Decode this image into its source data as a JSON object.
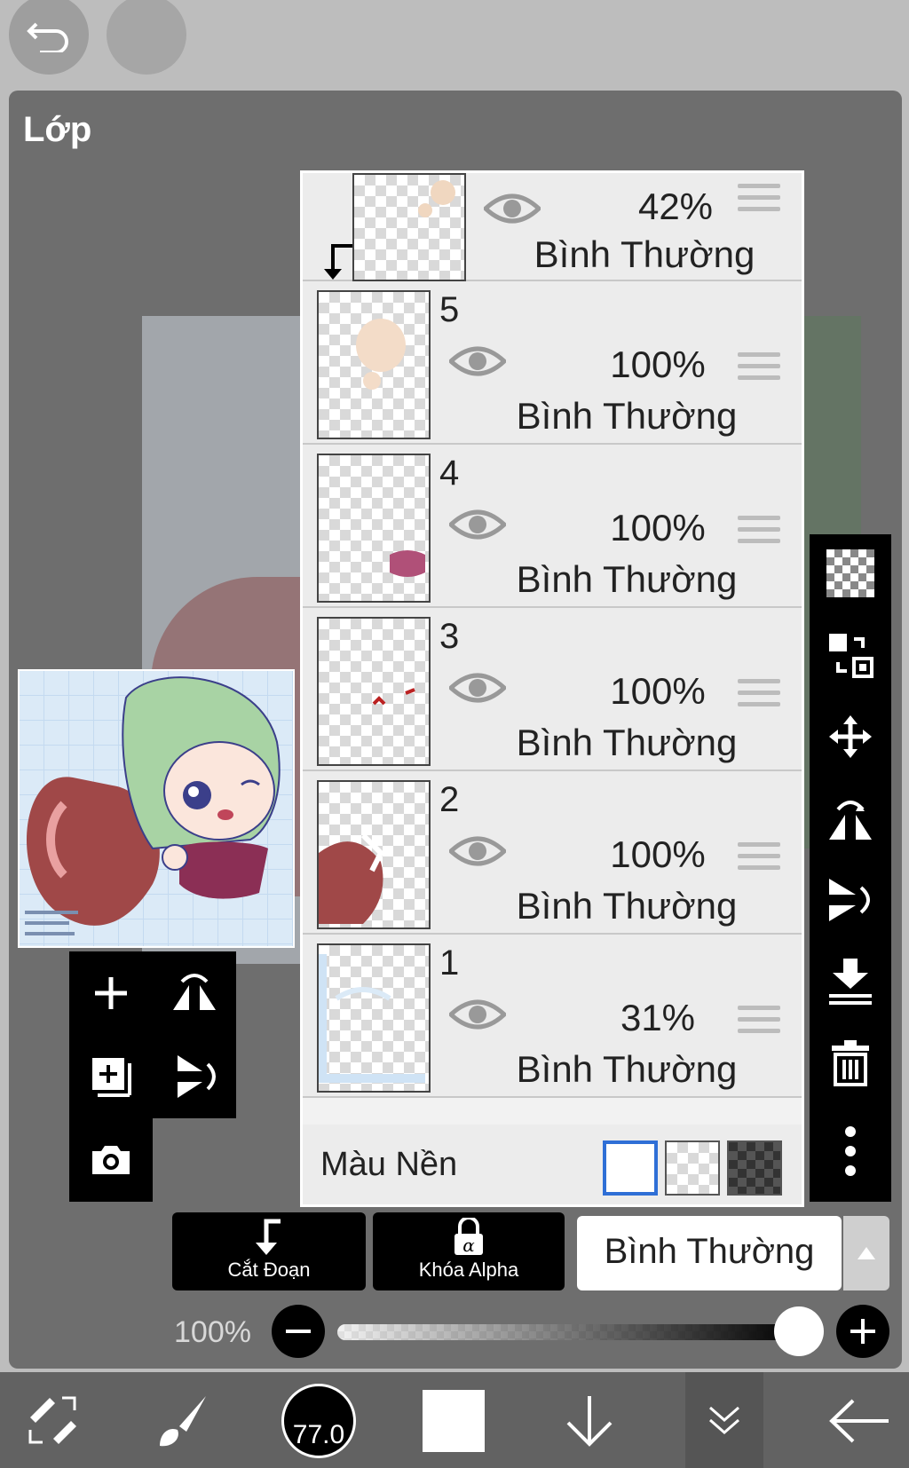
{
  "panel": {
    "title": "Lớp"
  },
  "top_bar": {
    "undo_icon": "undo-icon",
    "redo_icon": "redo-icon"
  },
  "layers": [
    {
      "number": "",
      "opacity": "42%",
      "blend": "Bình Thường",
      "clipped": true
    },
    {
      "number": "5",
      "opacity": "100%",
      "blend": "Bình Thường"
    },
    {
      "number": "4",
      "opacity": "100%",
      "blend": "Bình Thường"
    },
    {
      "number": "3",
      "opacity": "100%",
      "blend": "Bình Thường"
    },
    {
      "number": "2",
      "opacity": "100%",
      "blend": "Bình Thường"
    },
    {
      "number": "1",
      "opacity": "31%",
      "blend": "Bình Thường"
    }
  ],
  "background_row": {
    "label": "Màu Nền",
    "swatches": [
      "white",
      "transparent",
      "dark-checker"
    ],
    "selected": "white",
    "accent": "#2f6fd6"
  },
  "right_toolbar": [
    "transparency-icon",
    "swap-layers-icon",
    "move-icon",
    "flip-horizontal-icon",
    "flip-vertical-icon",
    "merge-down-icon",
    "trash-icon",
    "more-icon"
  ],
  "left_tools": [
    "add-layer-icon",
    "flip-horizontal-icon",
    "add-layer-copy-icon",
    "flip-vertical-icon",
    "camera-icon"
  ],
  "actions": {
    "clip_label": "Cắt Đoạn",
    "alpha_lock_label": "Khóa Alpha"
  },
  "blend_mode": {
    "selected": "Bình Thường"
  },
  "opacity": {
    "label": "100%",
    "value": 1.0
  },
  "bottom_bar": {
    "brush_size": "77.0",
    "icons": [
      "transform-tool-icon",
      "brush-icon",
      "brush-size-icon",
      "color-swatch-icon",
      "download-icon",
      "layers-collapse-icon",
      "back-icon"
    ]
  }
}
